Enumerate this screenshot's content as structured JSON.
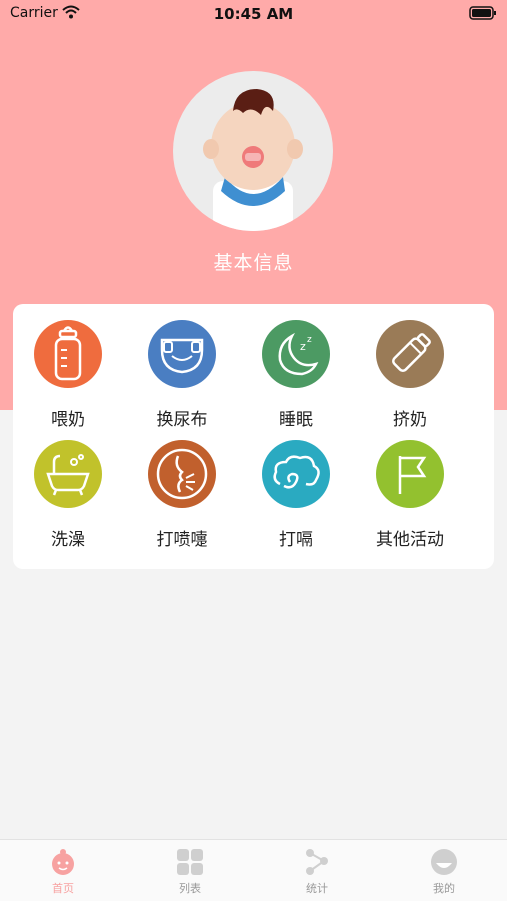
{
  "status_bar": {
    "carrier": "Carrier",
    "time": "10:45 AM"
  },
  "profile": {
    "title": "基本信息"
  },
  "activities": [
    {
      "label": "喂奶",
      "icon": "baby-bottle-icon",
      "color": "#ef6c3e"
    },
    {
      "label": "换尿布",
      "icon": "diaper-icon",
      "color": "#4a7ec2"
    },
    {
      "label": "睡眠",
      "icon": "moon-sleep-icon",
      "color": "#4c9a63"
    },
    {
      "label": "挤奶",
      "icon": "pump-bottle-icon",
      "color": "#9a7b57"
    },
    {
      "label": "洗澡",
      "icon": "bathtub-icon",
      "color": "#c1c22b"
    },
    {
      "label": "打喷嚏",
      "icon": "sneeze-icon",
      "color": "#c1602d"
    },
    {
      "label": "打嗝",
      "icon": "hiccup-cloud-icon",
      "color": "#2aaac1"
    },
    {
      "label": "其他活动",
      "icon": "flag-icon",
      "color": "#93c12f"
    }
  ],
  "tabs": [
    {
      "label": "首页",
      "icon": "home-baby-icon",
      "active": true
    },
    {
      "label": "列表",
      "icon": "grid-icon",
      "active": false
    },
    {
      "label": "统计",
      "icon": "stats-icon",
      "active": false
    },
    {
      "label": "我的",
      "icon": "profile-icon",
      "active": false
    }
  ],
  "colors": {
    "header": "#ffaaa9",
    "tab_active": "#f7a2a1",
    "tab_inactive": "#cfcfcf"
  }
}
